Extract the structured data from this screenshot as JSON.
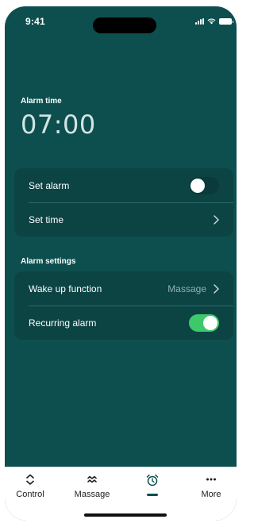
{
  "status_bar": {
    "time": "9:41"
  },
  "alarm": {
    "time_label": "Alarm time",
    "time_value": "07:00"
  },
  "alarm_card": {
    "set_alarm_label": "Set alarm",
    "set_alarm_enabled": false,
    "set_time_label": "Set time"
  },
  "settings": {
    "title": "Alarm settings",
    "wake_up_label": "Wake up function",
    "wake_up_value": "Massage",
    "recurring_label": "Recurring alarm",
    "recurring_enabled": true
  },
  "tabs": [
    {
      "label": "Control",
      "icon": "chevron-updown-icon"
    },
    {
      "label": "Massage",
      "icon": "massage-waves-icon"
    },
    {
      "label": "",
      "icon": "alarm-clock-icon",
      "active": true
    },
    {
      "label": "More",
      "icon": "more-dots-icon"
    }
  ],
  "colors": {
    "background": "#0d4f4f",
    "card": "#0c4444",
    "toggle_on": "#3dc86a",
    "tab_bar": "#ffffff"
  }
}
